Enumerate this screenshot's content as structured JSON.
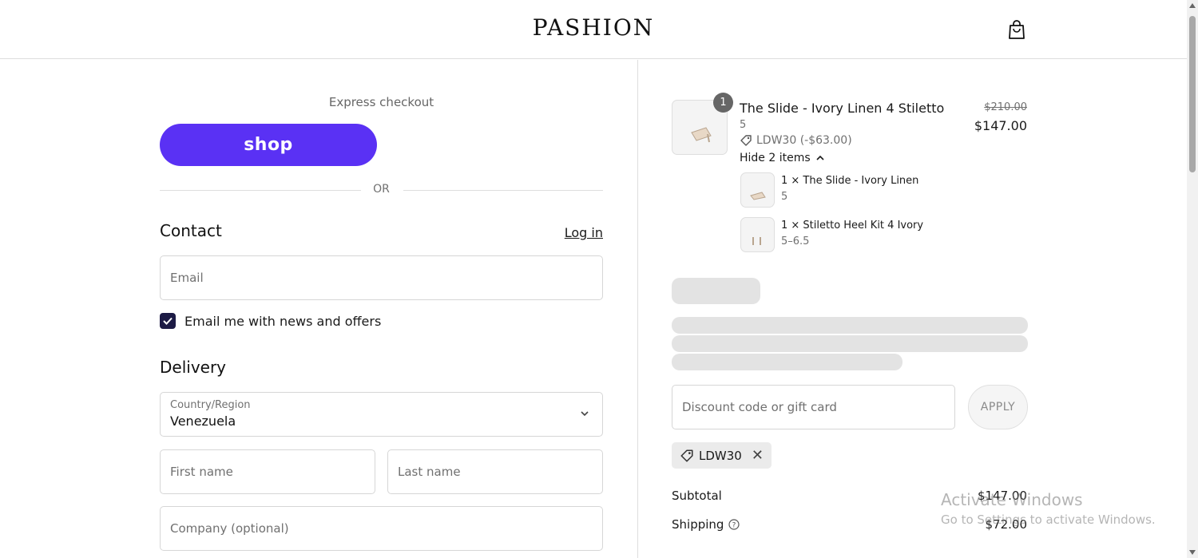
{
  "header": {
    "logo": "PASHION",
    "cart_icon": "shopping-bag-icon"
  },
  "express": {
    "label": "Express checkout",
    "shop_button": "shop",
    "or_text": "OR"
  },
  "contact": {
    "title": "Contact",
    "login_link": "Log in",
    "email_placeholder": "Email",
    "newsletter_label": "Email me with news and offers",
    "newsletter_checked": true
  },
  "delivery": {
    "title": "Delivery",
    "country_label": "Country/Region",
    "country_value": "Venezuela",
    "first_name_placeholder": "First name",
    "last_name_placeholder": "Last name",
    "company_placeholder": "Company (optional)"
  },
  "order": {
    "item": {
      "quantity": "1",
      "title": "The Slide - Ivory Linen 4 Stiletto",
      "variant": "5",
      "discount": "LDW30 (-$63.00)",
      "price_old": "$210.00",
      "price_new": "$147.00",
      "hide_items": "Hide 2 items"
    },
    "bundle": [
      {
        "title": "1 × The Slide - Ivory Linen",
        "variant": "5"
      },
      {
        "title": "1 × Stiletto Heel Kit 4 Ivory",
        "variant": "5–6.5"
      }
    ],
    "discount_placeholder": "Discount code or gift card",
    "apply_button": "APPLY",
    "applied_code": "LDW30",
    "summary": {
      "subtotal_label": "Subtotal",
      "subtotal_value": "$147.00",
      "shipping_label": "Shipping",
      "shipping_value": "$72.00"
    }
  },
  "watermark": {
    "line1": "Activate Windows",
    "line2": "Go to Settings to activate Windows."
  },
  "colors": {
    "shop_button": "#5a31f4",
    "checkbox": "#1d1b45",
    "border": "#dedede"
  }
}
